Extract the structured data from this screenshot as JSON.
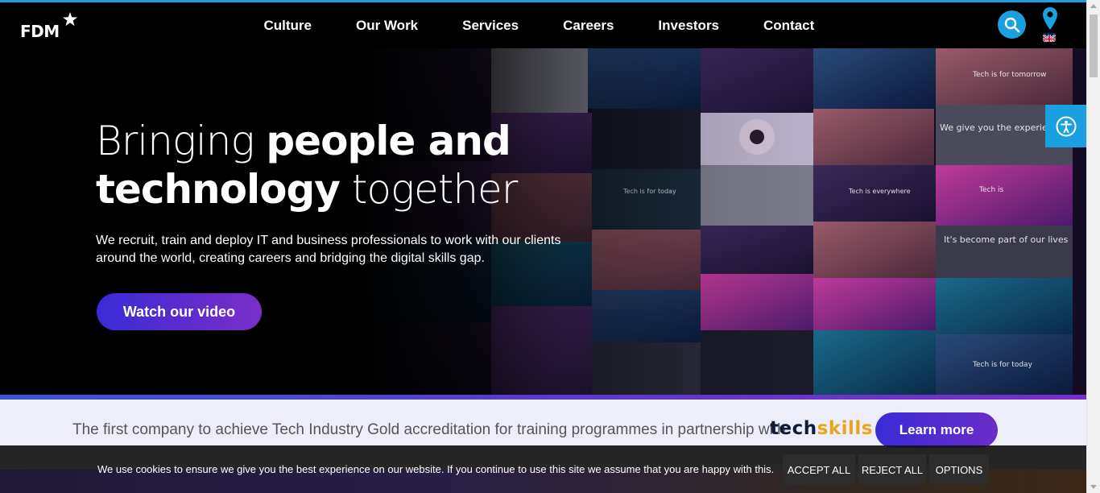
{
  "header": {
    "logo_text": "FDM",
    "nav": [
      "Culture",
      "Our Work",
      "Services",
      "Careers",
      "Investors",
      "Contact"
    ]
  },
  "hero": {
    "title_light_1": "Bringing ",
    "title_bold_1": "people and",
    "title_bold_2": "technology",
    "title_light_2": " together",
    "subtitle": "We recruit, train and deploy IT and business professionals to work with our clients around the world, creating careers and bridging the digital skills gap.",
    "cta_label": "Watch our video",
    "mosaic_captions": [
      "Tech is for tomorrow",
      "We give you the experien",
      "Tech is for today",
      "Tech is everywhere",
      "Tech is",
      "It's become part of our lives",
      "Tech is for today"
    ]
  },
  "banner": {
    "text": "The first company to achieve Tech Industry Gold accreditation for training programmes in partnership with",
    "brand_part1": "tech",
    "brand_part2": "skills",
    "cta_label": "Learn more"
  },
  "cookie": {
    "text": "We use cookies to ensure we give you the best experience on our website. If you continue to use this site we assume that you are happy with this.",
    "accept_label": "ACCEPT ALL",
    "reject_label": "REJECT ALL",
    "options_label": "OPTIONS"
  },
  "colors": {
    "accent_blue": "#1aa0e0",
    "button_purple_start": "#3a2bd6",
    "button_purple_end": "#7a2ec8",
    "banner_bg": "#eeeefa",
    "techskills_navy": "#0d1b3c",
    "techskills_gold": "#e7a51a"
  }
}
